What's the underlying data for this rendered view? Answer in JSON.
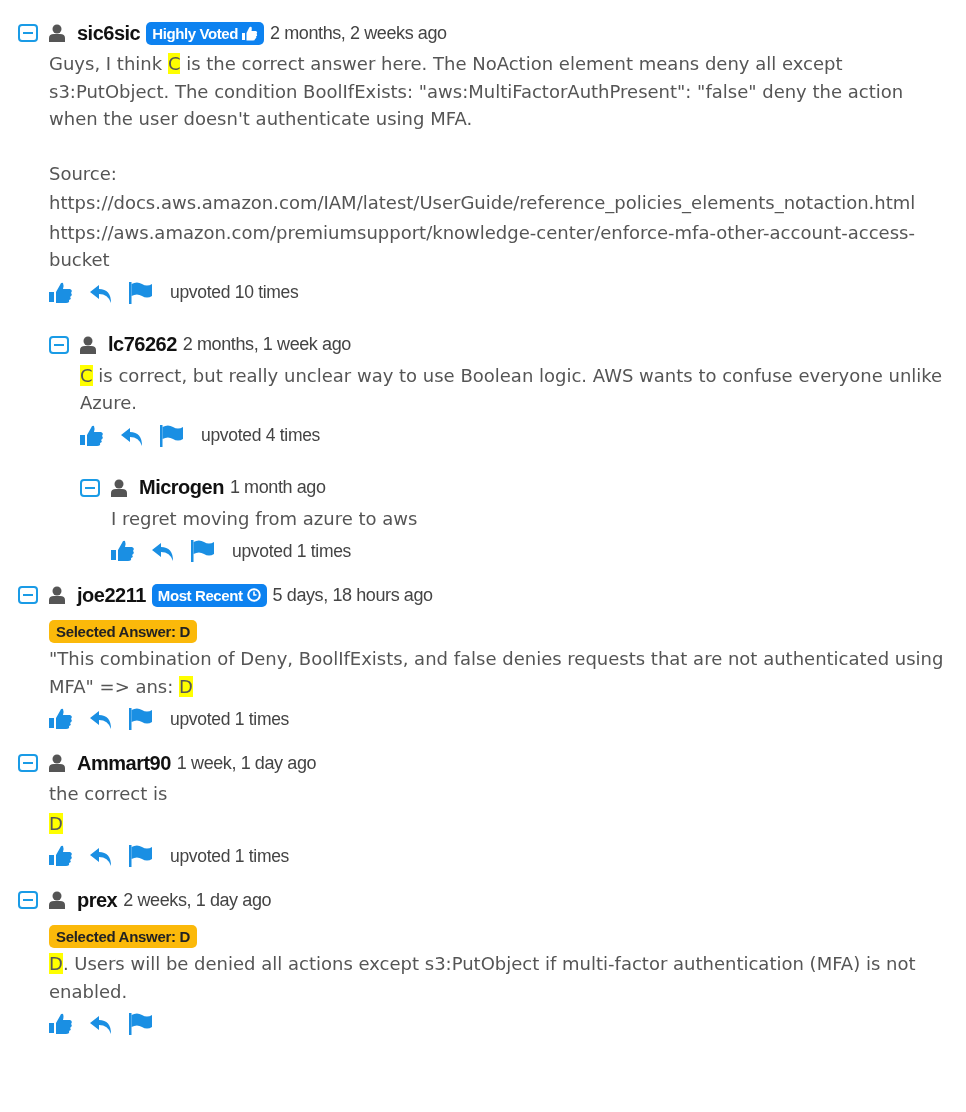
{
  "comments": [
    {
      "user": "sic6sic",
      "expanded": true,
      "badge": {
        "kind": "highly_voted",
        "label": "Highly Voted"
      },
      "time": "2 months, 2 weeks ago",
      "paragraphs": [
        [
          {
            "text": "Guys, I think "
          },
          {
            "text": "C",
            "highlighted": true
          },
          {
            "text": " is the correct answer here. The NoAction element means deny all except s3:PutObject. The condition BoolIfExists: \"aws:MultiFactorAuthPresent\": \"false\" deny the action when the user doesn't authenticate using MFA."
          }
        ],
        [
          {
            "text": "Source:"
          }
        ],
        [
          {
            "text": "https://docs.aws.amazon.com/IAM/latest/UserGuide/reference_policies_elements_notaction.html"
          }
        ],
        [
          {
            "text": "https://aws.amazon.com/premiumsupport/knowledge-center/enforce-mfa-other-account-access-bucket"
          }
        ]
      ],
      "upvotes": "upvoted 10 times",
      "children": [
        {
          "user": "lc76262",
          "expanded": true,
          "time": "2 months, 1 week ago",
          "paragraphs": [
            [
              {
                "text": "C",
                "highlighted": true
              },
              {
                "text": " is correct, but really unclear way to use Boolean logic. AWS wants to confuse everyone unlike Azure."
              }
            ]
          ],
          "upvotes": "upvoted 4 times",
          "children": [
            {
              "user": "Microgen",
              "expanded": true,
              "time": "1 month ago",
              "paragraphs": [
                [
                  {
                    "text": "I regret moving from azure to aws"
                  }
                ]
              ],
              "upvotes": "upvoted 1 times"
            }
          ]
        }
      ]
    },
    {
      "user": "joe2211",
      "expanded": true,
      "badge": {
        "kind": "most_recent",
        "label": "Most Recent"
      },
      "time": "5 days, 18 hours ago",
      "selected_answer": "Selected Answer: D",
      "paragraphs": [
        [
          {
            "text": "\"This combination of Deny, BoolIfExists, and false denies requests that are not authenticated using MFA\" => ans: "
          },
          {
            "text": "D ",
            "highlighted": true
          }
        ]
      ],
      "upvotes": "upvoted 1 times"
    },
    {
      "user": "Ammart90",
      "expanded": true,
      "time": "1 week, 1 day ago",
      "paragraphs": [
        [
          {
            "text": "the correct is"
          }
        ],
        [
          {
            "text": "D ",
            "highlighted": true
          }
        ]
      ],
      "upvotes": "upvoted 1 times"
    },
    {
      "user": "prex",
      "expanded": true,
      "time": "2 weeks, 1 day ago",
      "selected_answer": "Selected Answer: D",
      "paragraphs": [
        [
          {
            "text": "D",
            "highlighted": true
          },
          {
            "text": ". Users will be denied all actions except s3:PutObject if multi-factor authentication (MFA) is not enabled."
          }
        ]
      ]
    }
  ]
}
